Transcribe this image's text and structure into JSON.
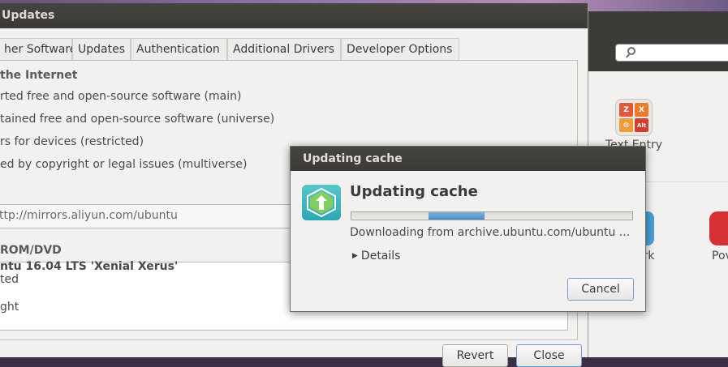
{
  "settings": {
    "search_placeholder": "",
    "text_entry_label": "Text Entry",
    "network_label": "ork",
    "power_label": "Pov",
    "text_entry_keys": [
      "Z",
      "X",
      "⊙",
      "Alt"
    ]
  },
  "software_window": {
    "title": "Updates",
    "tabs": [
      "her Software",
      "Updates",
      "Authentication",
      "Additional Drivers",
      "Developer Options"
    ],
    "internet_section_title": "the Internet",
    "repos": [
      "rted free and open-source software (main)",
      "tained free and open-source software (universe)",
      "rs for devices (restricted)",
      "ed by copyright or legal issues (multiverse)"
    ],
    "server_url": "ttp://mirrors.aliyun.com/ubuntu",
    "cdrom_title": "ROM/DVD",
    "cdrom_lines": [
      "ntu 16.04 LTS 'Xenial Xerus'",
      "ted",
      "ght"
    ],
    "revert_label": "Revert",
    "close_label": "Close"
  },
  "dialog": {
    "title": "Updating cache",
    "heading": "Updating cache",
    "progress_fraction": 0.2,
    "status": "Downloading from archive.ubuntu.com/ubuntu ...",
    "details_label": "Details",
    "cancel_label": "Cancel"
  }
}
